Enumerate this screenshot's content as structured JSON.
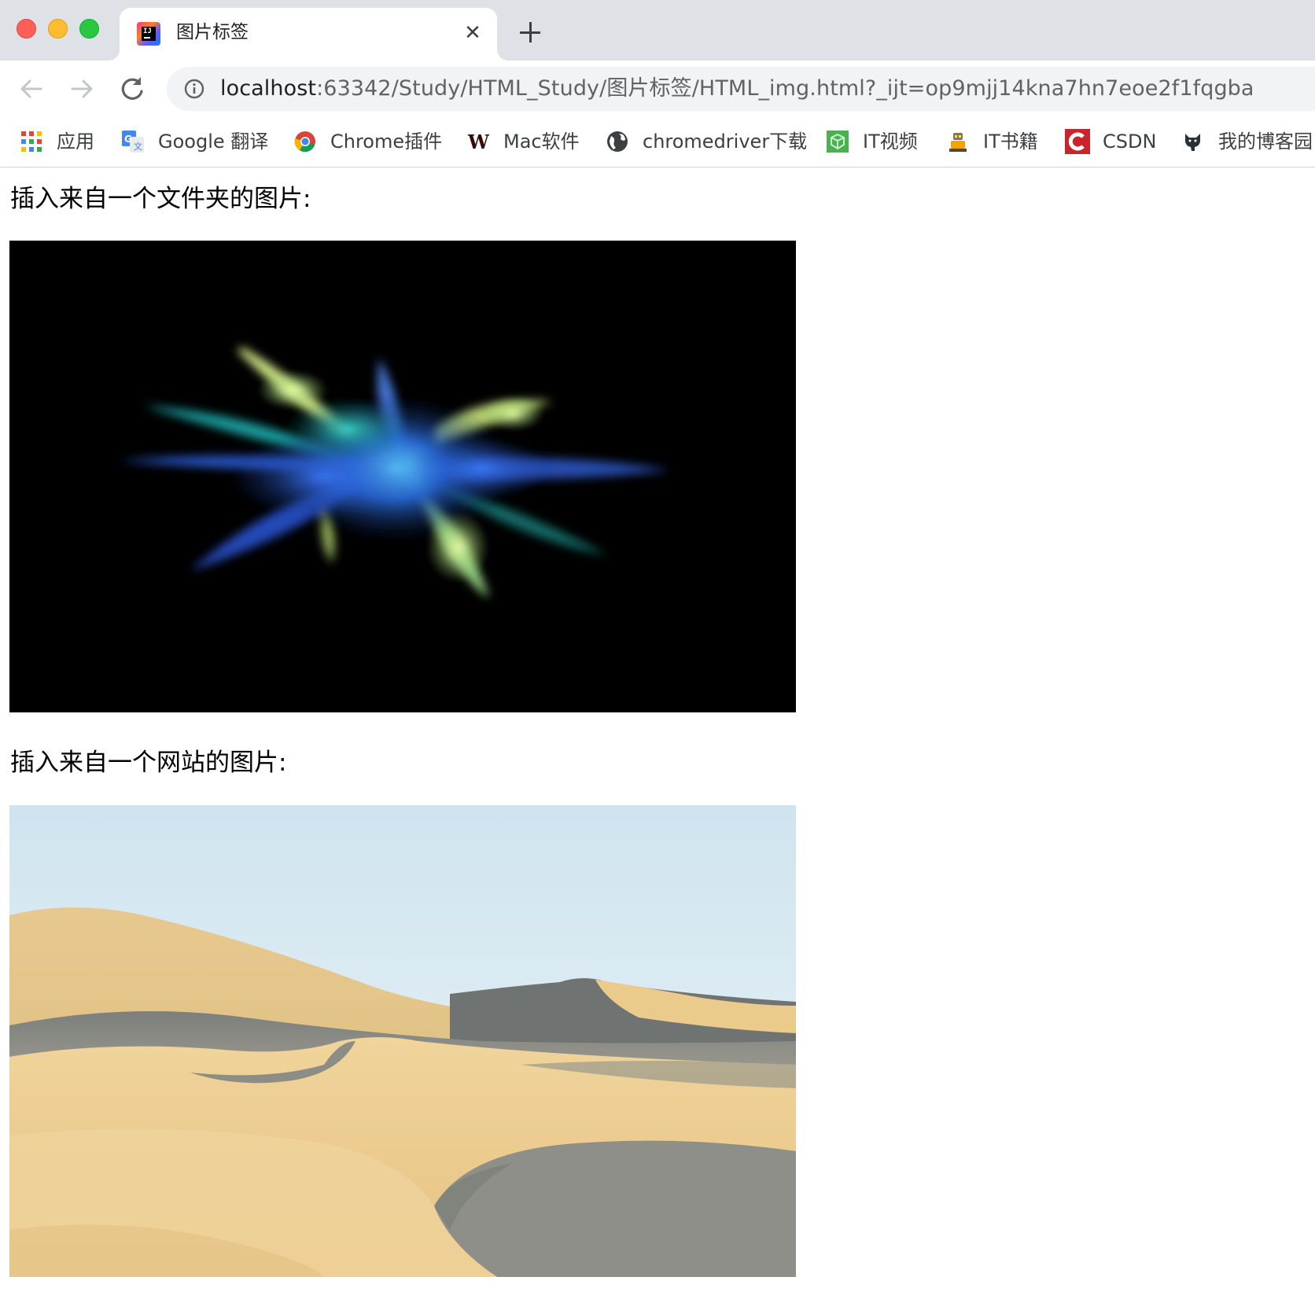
{
  "window": {
    "tab": {
      "title": "图片标签",
      "favicon": "intellij-icon",
      "close": "✕"
    }
  },
  "toolbar": {
    "back_icon": "arrow-left-icon",
    "forward_icon": "arrow-right-icon",
    "reload_icon": "reload-icon",
    "address": {
      "host": "localhost",
      "rest": ":63342/Study/HTML_Study/图片标签/HTML_img.html?_ijt=op9mjj14kna7hn7eoe2f1fqgba"
    }
  },
  "bookmarks": [
    {
      "label": "应用",
      "icon": "apps-grid-icon"
    },
    {
      "label": "Google 翻译",
      "icon": "google-translate-icon"
    },
    {
      "label": "Chrome插件",
      "icon": "chrome-icon"
    },
    {
      "label": "Mac软件",
      "icon": "w-logo-icon"
    },
    {
      "label": "chromedriver下载",
      "icon": "globe-icon"
    },
    {
      "label": "IT视频",
      "icon": "green-cube-icon"
    },
    {
      "label": "IT书籍",
      "icon": "robot-icon"
    },
    {
      "label": "CSDN",
      "icon": "csdn-icon"
    },
    {
      "label": "我的博客园",
      "icon": "cat-icon"
    }
  ],
  "page": {
    "heading_folder": "插入来自一个文件夹的图片:",
    "heading_website": "插入来自一个网站的图片:"
  }
}
